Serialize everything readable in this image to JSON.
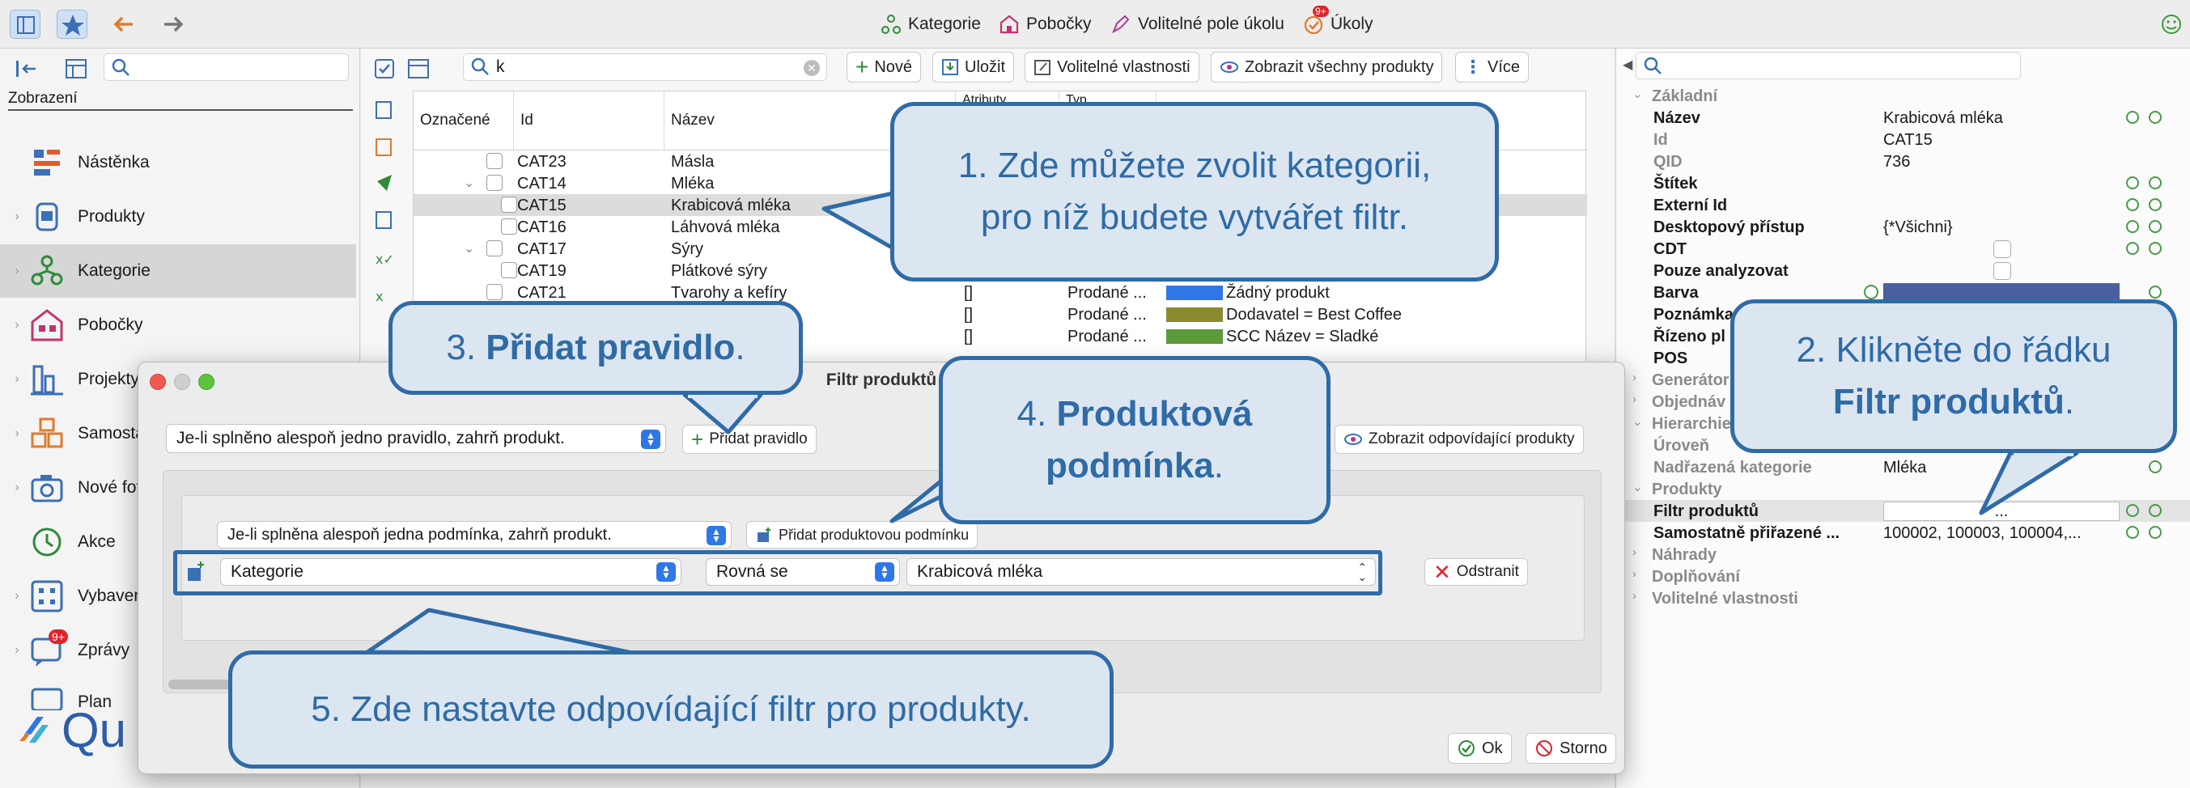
{
  "topbar": {
    "buttons": [
      "Kategorie",
      "Pobočky",
      "Volitelné pole úkolu",
      "Úkoly"
    ],
    "badge": "9+"
  },
  "sidebar": {
    "section_label": "Zobrazení",
    "items": [
      {
        "label": "Nástěnka"
      },
      {
        "label": "Produkty"
      },
      {
        "label": "Kategorie"
      },
      {
        "label": "Pobočky"
      },
      {
        "label": "Projekty planogramů"
      },
      {
        "label": "Samosta"
      },
      {
        "label": "Nové fot"
      },
      {
        "label": "Akce"
      },
      {
        "label": "Vybaver"
      },
      {
        "label": "Zprávy"
      },
      {
        "label": "Plan"
      }
    ],
    "badge": "9+",
    "logo_text": "Qu"
  },
  "center": {
    "search_value": "k",
    "toolbar": {
      "new": "Nové",
      "save": "Uložit",
      "custom_props": "Volitelné vlastnosti",
      "show_all": "Zobrazit všechny produkty",
      "more": "Více"
    },
    "columns": [
      "Označené",
      "Id",
      "Název",
      "Atributy",
      "Typ"
    ],
    "rows": [
      {
        "id": "CAT23",
        "name": "Másla",
        "attr": "",
        "type": "",
        "extra": ""
      },
      {
        "id": "CAT14",
        "name": "Mléka",
        "attr": "",
        "type": "",
        "extra": ""
      },
      {
        "id": "CAT15",
        "name": "Krabicová mléka",
        "attr": "",
        "type": "",
        "extra": ""
      },
      {
        "id": "CAT16",
        "name": "Láhvová mléka",
        "attr": "",
        "type": "",
        "extra": ""
      },
      {
        "id": "CAT17",
        "name": "Sýry",
        "attr": "",
        "type": "",
        "extra": ""
      },
      {
        "id": "CAT19",
        "name": "Plátkové sýry",
        "attr": "",
        "type": "",
        "extra": ""
      },
      {
        "id": "CAT21",
        "name": "Tvarohy a kefíry",
        "attr": "[]",
        "type": "Prodané ...",
        "extra": "Žádný produkt"
      },
      {
        "id": "",
        "name": "",
        "attr": "[]",
        "type": "Prodané ...",
        "extra": "Dodavatel = Best Coffee"
      },
      {
        "id": "",
        "name": "",
        "attr": "[]",
        "type": "Prodané ...",
        "extra": "SCC Název = Sladké"
      }
    ]
  },
  "right": {
    "groups": {
      "zakladni": "Základní",
      "generator": "Generátor",
      "objednavani": "Objednáv",
      "hierarchie": "Hierarchie",
      "produkty": "Produkty",
      "nahrady": "Náhrady",
      "doplnovani": "Doplňování",
      "volitelne": "Volitelné vlastnosti"
    },
    "props": {
      "nazev": {
        "name": "Název",
        "value": "Krabicová mléka"
      },
      "id": {
        "name": "Id",
        "value": "CAT15"
      },
      "qid": {
        "name": "QID",
        "value": "736"
      },
      "stitek": {
        "name": "Štítek",
        "value": ""
      },
      "externi": {
        "name": "Externí Id",
        "value": ""
      },
      "desktop": {
        "name": "Desktopový přístup",
        "value": "{*Všichni}"
      },
      "cdt": {
        "name": "CDT",
        "value": ""
      },
      "pouze": {
        "name": "Pouze analyzovat",
        "value": ""
      },
      "barva": {
        "name": "Barva",
        "value": ""
      },
      "poznamka": {
        "name": "Poznámka",
        "value": ""
      },
      "rizeno": {
        "name": "Řízeno pl",
        "value": ""
      },
      "pos": {
        "name": "POS",
        "value": ""
      },
      "uroven": {
        "name": "Úroveň",
        "value": ""
      },
      "nadrazena": {
        "name": "Nadřazená kategorie",
        "value": "Mléka"
      },
      "filtr": {
        "name": "Filtr produktů",
        "value": "..."
      },
      "samostatne": {
        "name": "Samostatně přiřazené ...",
        "value": "100002, 100003, 100004,..."
      }
    },
    "colors": {
      "barva": "#4b5fa0"
    }
  },
  "dialog": {
    "title": "Filtr produktů",
    "outer_rule": "Je-li splněno alespoň jedno pravidlo, zahrň produkt.",
    "add_rule": "Přidat pravidlo",
    "show_matching": "Zobrazit odpovídající produkty",
    "inner_rule": "Je-li splněna alespoň jedna podmínka, zahrň produkt.",
    "add_condition": "Přidat produktovou podmínku",
    "field": "Kategorie",
    "operator": "Rovná se",
    "value": "Krabicová mléka",
    "remove": "Odstranit",
    "ok": "Ok",
    "cancel": "Storno"
  },
  "callouts": {
    "c1_line1": "1. Zde můžete zvolit kategorii,",
    "c1_line2": "pro níž budete vytvářet filtr.",
    "c2_line1": "2. Klikněte do řádku",
    "c2_bold": "Filtr produktů",
    "c2_end": ".",
    "c3_pre": "3. ",
    "c3_bold": "Přidat pravidlo",
    "c3_end": ".",
    "c4_pre": "4. ",
    "c4_bold1": "Produktová",
    "c4_bold2": "podmínka",
    "c4_end": ".",
    "c5": "5. Zde nastavte odpovídající filtr pro produkty."
  }
}
